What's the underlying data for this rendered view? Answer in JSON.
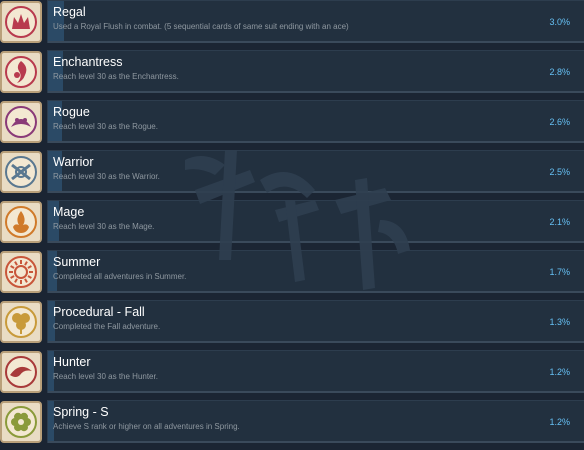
{
  "achievements": [
    {
      "title": "Regal",
      "desc": "Used a Royal Flush in combat. (5 sequential cards of same suit ending with an ace)",
      "pct": "3.0%",
      "value": 3.0,
      "icon": "royal-flush-icon",
      "color": "#b83a4e"
    },
    {
      "title": "Enchantress",
      "desc": "Reach level 30 as the Enchantress.",
      "pct": "2.8%",
      "value": 2.8,
      "icon": "enchantress-icon",
      "color": "#b83a4e"
    },
    {
      "title": "Rogue",
      "desc": "Reach level 30 as the Rogue.",
      "pct": "2.6%",
      "value": 2.6,
      "icon": "rogue-icon",
      "color": "#8a3a78"
    },
    {
      "title": "Warrior",
      "desc": "Reach level 30 as the Warrior.",
      "pct": "2.5%",
      "value": 2.5,
      "icon": "warrior-icon",
      "color": "#5a7890"
    },
    {
      "title": "Mage",
      "desc": "Reach level 30 as the Mage.",
      "pct": "2.1%",
      "value": 2.1,
      "icon": "mage-icon",
      "color": "#d07a2a"
    },
    {
      "title": "Summer",
      "desc": "Completed all adventures in Summer.",
      "pct": "1.7%",
      "value": 1.7,
      "icon": "sun-icon",
      "color": "#c8563a"
    },
    {
      "title": "Procedural - Fall",
      "desc": "Completed the Fall adventure.",
      "pct": "1.3%",
      "value": 1.3,
      "icon": "leaf-icon",
      "color": "#c89a3a"
    },
    {
      "title": "Hunter",
      "desc": "Reach level 30 as the Hunter.",
      "pct": "1.2%",
      "value": 1.2,
      "icon": "hunter-icon",
      "color": "#a83a3a"
    },
    {
      "title": "Spring - S",
      "desc": "Achieve S rank or higher on all adventures in Spring.",
      "pct": "1.2%",
      "value": 1.2,
      "icon": "flower-icon",
      "color": "#8a9a3a"
    }
  ],
  "colors": {
    "background": "#1b2533",
    "accent": "#66c0f4",
    "fill": "#2b4a66"
  }
}
